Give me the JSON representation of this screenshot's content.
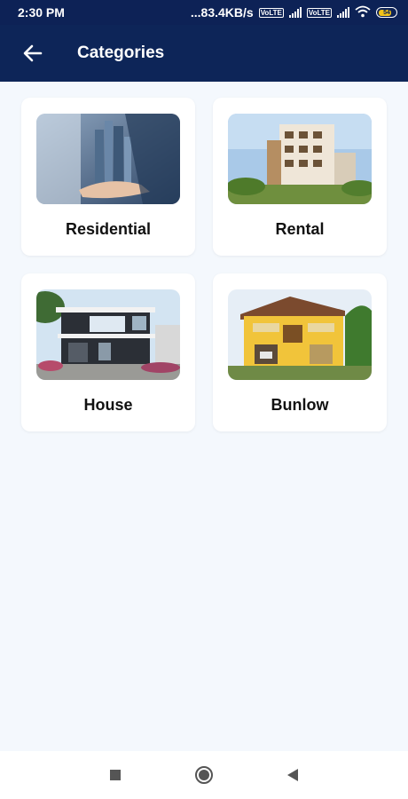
{
  "status_bar": {
    "time": "2:30 PM",
    "network_speed": "...83.4KB/s",
    "sim_tag_1": "VoLTE",
    "sim_tag_2": "VoLTE",
    "battery_level": "54",
    "icons": [
      "signal-icon",
      "signal-icon",
      "wifi-icon",
      "battery-icon"
    ]
  },
  "app_bar": {
    "title": "Categories",
    "back_icon": "arrow-left-icon",
    "background_color": "#0d2558"
  },
  "categories": [
    {
      "label": "Residential",
      "image": "hand-holding-skyscrapers-image"
    },
    {
      "label": "Rental",
      "image": "apartment-building-image"
    },
    {
      "label": "House",
      "image": "modern-house-image"
    },
    {
      "label": "Bunlow",
      "image": "yellow-bungalow-image"
    }
  ],
  "nav_bar": {
    "icons": [
      "recent-apps-icon",
      "home-icon",
      "back-icon"
    ]
  }
}
